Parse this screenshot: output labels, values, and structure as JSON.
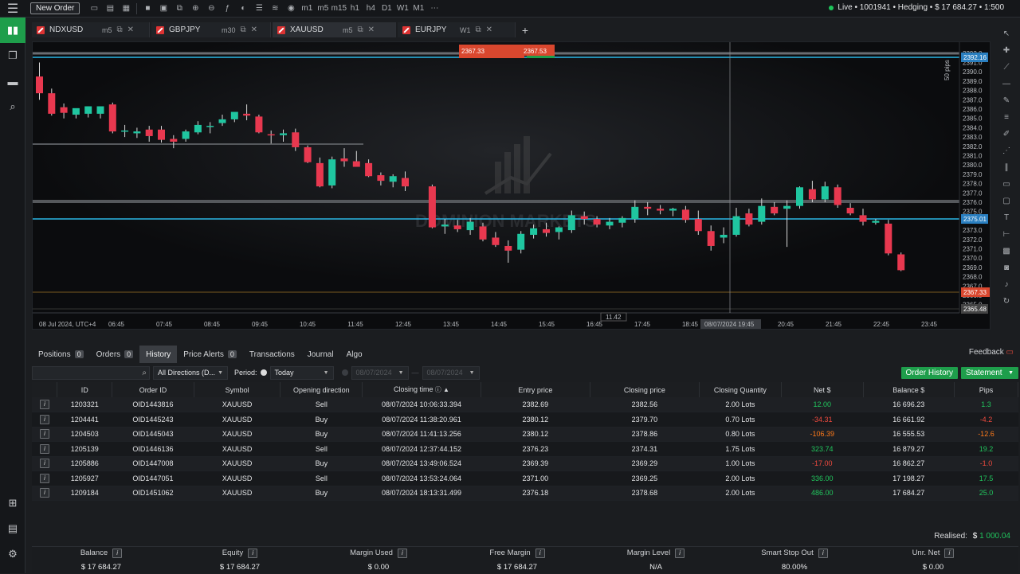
{
  "topbar": {
    "new_order": "New Order",
    "status": "Live • 1001941 • Hedging • $ 17 684.27 • 1:500",
    "timeframes": [
      "m1",
      "m5",
      "m15",
      "h1",
      "h4",
      "D1",
      "W1",
      "M1"
    ]
  },
  "tabs": [
    {
      "symbol": "NDXUSD",
      "tf": "m5"
    },
    {
      "symbol": "GBPJPY",
      "tf": "m30"
    },
    {
      "symbol": "XAUUSD",
      "tf": "m5"
    },
    {
      "symbol": "EURJPY",
      "tf": "W1"
    }
  ],
  "chart": {
    "sell_price": "2367.33",
    "buy_price": "2367.53",
    "watermark": "DOMINION MARKETS",
    "y_ticks": [
      "2392.0",
      "2391.0",
      "2390.0",
      "2389.0",
      "2388.0",
      "2387.0",
      "2386.0",
      "2385.0",
      "2384.0",
      "2383.0",
      "2382.0",
      "2381.0",
      "2380.0",
      "2379.0",
      "2378.0",
      "2377.0",
      "2376.0",
      "2375.0",
      "2374.0",
      "2373.0",
      "2372.0",
      "2371.0",
      "2370.0",
      "2369.0",
      "2368.0",
      "2367.0",
      "2366.0",
      "2365.0"
    ],
    "x_ticks": [
      "08 Jul 2024, UTC+4",
      "06:45",
      "07:45",
      "08:45",
      "09:45",
      "10:45",
      "11:45",
      "12:45",
      "13:45",
      "14:45",
      "15:45",
      "16:45",
      "17:45",
      "18:45",
      "19:45",
      "20:45",
      "21:45",
      "22:45",
      "23:45"
    ],
    "cursor_time": "08/07/2024 19:45",
    "cursor_value": "11.42",
    "tag_top": "2392.16",
    "tag_mid": "2375.01",
    "tag_price": "2367.33",
    "tag_low": "2365.48",
    "pips_label": "50 pips"
  },
  "bottom_tabs": [
    {
      "label": "Positions",
      "count": "0"
    },
    {
      "label": "Orders",
      "count": "0"
    },
    {
      "label": "History",
      "count": ""
    },
    {
      "label": "Price Alerts",
      "count": "0"
    },
    {
      "label": "Transactions",
      "count": ""
    },
    {
      "label": "Journal",
      "count": ""
    },
    {
      "label": "Algo",
      "count": ""
    }
  ],
  "feedback": "Feedback",
  "filters": {
    "direction": "All Directions (D...",
    "period_label": "Period:",
    "period": "Today",
    "date_from": "08/07/2024",
    "date_to": "08/07/2024",
    "order_history": "Order History",
    "statement": "Statement"
  },
  "table": {
    "headers": [
      "ID",
      "Order ID",
      "Symbol",
      "Opening direction",
      "Closing time",
      "Entry price",
      "Closing price",
      "Closing Quantity",
      "Net $",
      "Balance $",
      "Pips"
    ],
    "rows": [
      [
        "1203321",
        "OID1443816",
        "XAUUSD",
        "Sell",
        "08/07/2024 10:06:33.394",
        "2382.69",
        "2382.56",
        "2.00 Lots",
        "12.00",
        "16 696.23",
        "1.3"
      ],
      [
        "1204441",
        "OID1445243",
        "XAUUSD",
        "Buy",
        "08/07/2024 11:38:20.961",
        "2380.12",
        "2379.70",
        "0.70 Lots",
        "-34.31",
        "16 661.92",
        "-4.2"
      ],
      [
        "1204503",
        "OID1445043",
        "XAUUSD",
        "Buy",
        "08/07/2024 11:41:13.256",
        "2380.12",
        "2378.86",
        "0.80 Lots",
        "-106.39",
        "16 555.53",
        "-12.6"
      ],
      [
        "1205139",
        "OID1446136",
        "XAUUSD",
        "Sell",
        "08/07/2024 12:37:44.152",
        "2376.23",
        "2374.31",
        "1.75 Lots",
        "323.74",
        "16 879.27",
        "19.2"
      ],
      [
        "1205886",
        "OID1447008",
        "XAUUSD",
        "Buy",
        "08/07/2024 13:49:06.524",
        "2369.39",
        "2369.29",
        "1.00 Lots",
        "-17.00",
        "16 862.27",
        "-1.0"
      ],
      [
        "1205927",
        "OID1447051",
        "XAUUSD",
        "Sell",
        "08/07/2024 13:53:24.064",
        "2371.00",
        "2369.25",
        "2.00 Lots",
        "336.00",
        "17 198.27",
        "17.5"
      ],
      [
        "1209184",
        "OID1451062",
        "XAUUSD",
        "Buy",
        "08/07/2024 18:13:31.499",
        "2376.18",
        "2378.68",
        "2.00 Lots",
        "486.00",
        "17 684.27",
        "25.0"
      ]
    ]
  },
  "realised_label": "Realised:",
  "realised_value": "$ 1 000.04",
  "summary": [
    {
      "label": "Balance",
      "value": "$ 17 684.27"
    },
    {
      "label": "Equity",
      "value": "$ 17 684.27"
    },
    {
      "label": "Margin Used",
      "value": "$ 0.00"
    },
    {
      "label": "Free Margin",
      "value": "$ 17 684.27"
    },
    {
      "label": "Margin Level",
      "value": "N/A"
    },
    {
      "label": "Smart Stop Out",
      "value": "80.00%"
    },
    {
      "label": "Unr. Net",
      "value": "$ 0.00"
    }
  ],
  "colors": {
    "accent": "#1e9e4b",
    "up": "#1fc6a0",
    "down": "#e8384f",
    "cyan_line": "#2bb7e6"
  }
}
